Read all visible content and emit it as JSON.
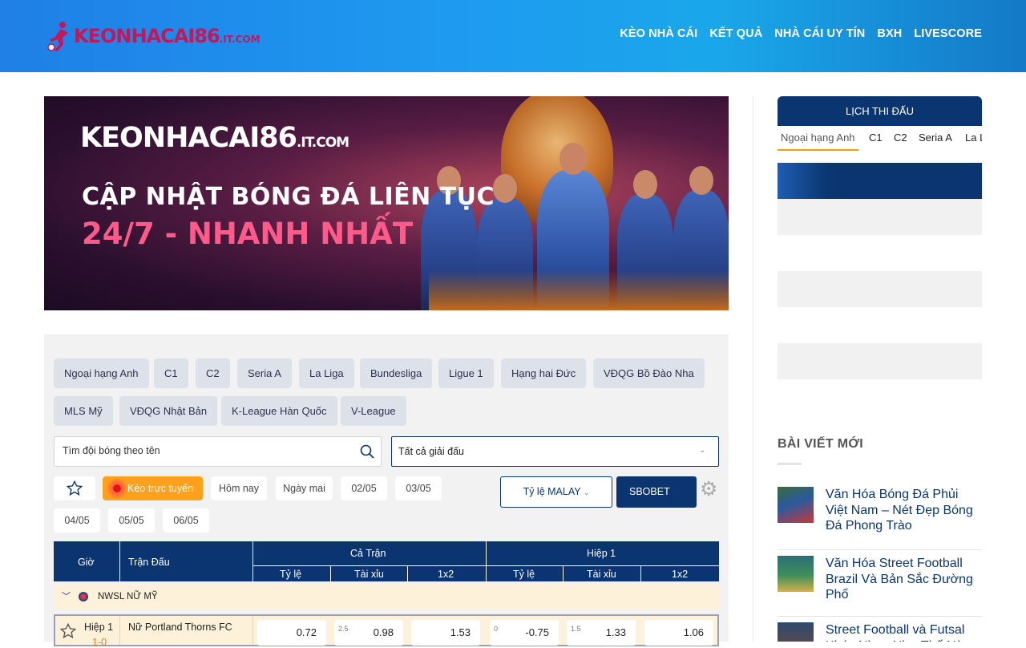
{
  "header": {
    "logo_main": "KEONHACAI86",
    "logo_suffix": ".IT.COM",
    "nav": [
      "KÈO NHÀ CÁI",
      "KẾT QUẢ",
      "NHÀ CÁI UY TÍN",
      "BXH",
      "LIVESCORE"
    ]
  },
  "banner": {
    "logo_main": "KEONHACAI86",
    "logo_suffix": ".IT.COM",
    "line1": "CẬP NHẬT BÓNG ĐÁ LIÊN TỤC",
    "line2": "24/7 - NHANH NHẤT"
  },
  "leagues": [
    "Ngoại hạng Anh",
    "C1",
    "C2",
    "Seria A",
    "La Liga",
    "Bundesliga",
    "Ligue 1",
    "Hạng hai Đức",
    "VĐQG Bồ Đào Nha",
    "MLS Mỹ",
    "VĐQG Nhật Bản",
    "K-League Hàn Quốc",
    "V-League"
  ],
  "search": {
    "placeholder": "Tìm đội bóng theo tên",
    "select_value": "Tất cả giải đấu"
  },
  "dates": {
    "live_label": "Kèo trực tuyến",
    "items": [
      "Hôm nay",
      "Ngày mai",
      "02/05",
      "03/05",
      "04/05",
      "05/05",
      "06/05"
    ]
  },
  "odds_controls": {
    "odds_type": "Tỷ lệ MALAY",
    "bookmaker": "SBOBET"
  },
  "table": {
    "col_time": "Giờ",
    "col_match": "Trận Đấu",
    "group_full": "Cả Trận",
    "group_half": "Hiệp 1",
    "sub_cols": [
      "Tỷ lệ",
      "Tài xỉu",
      "1x2",
      "Tỷ lệ",
      "Tài xỉu",
      "1x2"
    ],
    "league_name": "NWSL NỮ MỸ",
    "match": {
      "period": "Hiệp 1",
      "score": "1-0",
      "team": "Nữ Portland Thorns FC",
      "odds": [
        {
          "handicap": "",
          "value": "0.72"
        },
        {
          "handicap": "2.5",
          "value": "0.98"
        },
        {
          "handicap": "",
          "value": "1.53"
        },
        {
          "handicap": "0",
          "value": "-0.75"
        },
        {
          "handicap": "1.5",
          "value": "1.33"
        },
        {
          "handicap": "",
          "value": "1.06"
        }
      ]
    }
  },
  "sidebar": {
    "schedule_title": "LỊCH THI ĐẤU",
    "tabs": [
      "Ngoại hạng Anh",
      "C1",
      "C2",
      "Seria A",
      "La L"
    ],
    "recent_title": "BÀI VIẾT MỚI",
    "posts": [
      "Văn Hóa Bóng Đá Phủi Việt Nam – Nét Đẹp Bóng Đá Phong Trào",
      "Văn Hóa Street Football Brazil Và Bản Sắc Đường Phố",
      "Street Football và Futsal Khác Nhau Như Thế Nào"
    ]
  },
  "colors": {
    "navy": "#0a3570",
    "orange": "#ffa11a",
    "header_blue": "#1e9bf0"
  }
}
